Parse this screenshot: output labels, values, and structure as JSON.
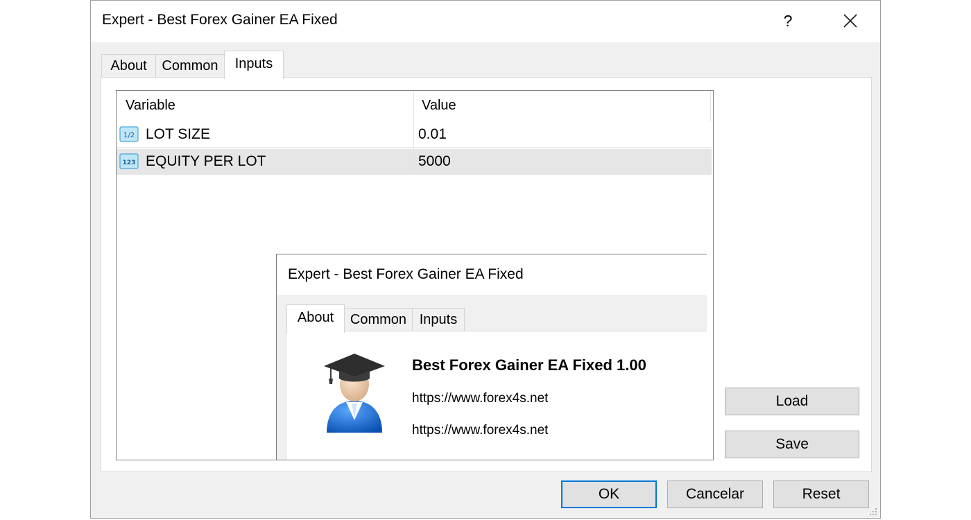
{
  "dialog": {
    "title": "Expert - Best Forex Gainer EA Fixed",
    "help_label": "?",
    "tabs": [
      {
        "label": "About",
        "active": false
      },
      {
        "label": "Common",
        "active": false
      },
      {
        "label": "Inputs",
        "active": true
      }
    ],
    "grid": {
      "columns": [
        "Variable",
        "Value"
      ],
      "rows": [
        {
          "icon": "fraction-type-icon",
          "icon_text": "1/2",
          "name": "LOT SIZE",
          "value": "0.01",
          "selected": false
        },
        {
          "icon": "integer-type-icon",
          "icon_text": "123",
          "name": "EQUITY PER LOT",
          "value": "5000",
          "selected": true
        }
      ]
    },
    "side_buttons": {
      "load": "Load",
      "save": "Save"
    },
    "footer_buttons": {
      "ok": "OK",
      "cancel": "Cancelar",
      "reset": "Reset"
    }
  },
  "inner_dialog": {
    "title": "Expert - Best Forex Gainer EA Fixed",
    "tabs": [
      {
        "label": "About",
        "active": true
      },
      {
        "label": "Common",
        "active": false
      },
      {
        "label": "Inputs",
        "active": false
      }
    ],
    "about": {
      "icon": "graduate-user-icon",
      "name_version": "Best Forex Gainer EA Fixed 1.00",
      "links": [
        "https://www.forex4s.net",
        "https://www.forex4s.net"
      ]
    }
  },
  "colors": {
    "focus_border": "#0078d7",
    "button_face": "#e1e1e1",
    "selected_row": "#e6e6e6",
    "avatar_blue": "#1f6fd0"
  }
}
